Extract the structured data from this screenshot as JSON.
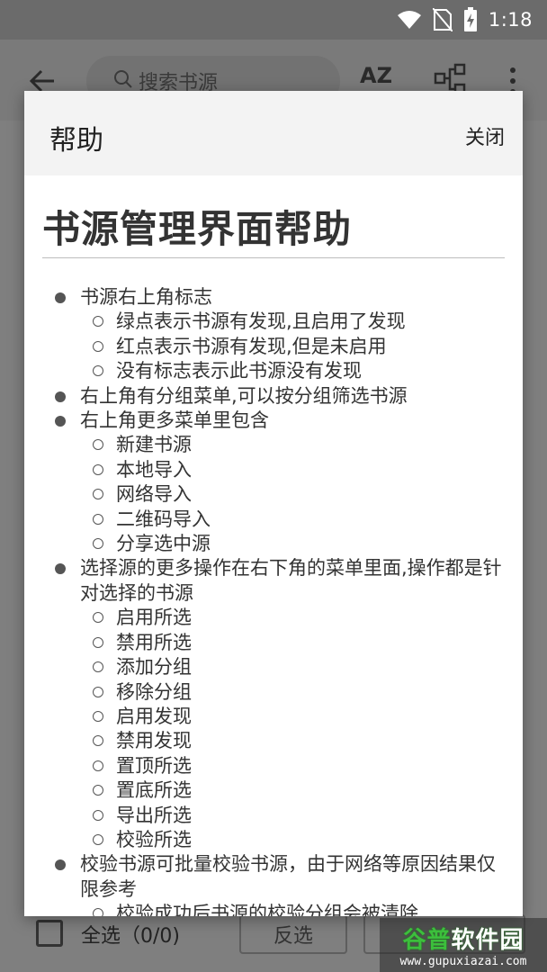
{
  "status_bar": {
    "time": "1:18",
    "icons": [
      "wifi-icon",
      "no-sim-icon",
      "battery-charging-icon"
    ]
  },
  "toolbar": {
    "search_placeholder": "搜索书源",
    "sort_label": "AZ",
    "icons": [
      "back-arrow-icon",
      "search-icon",
      "sort-az-icon",
      "group-icon",
      "more-vert-icon"
    ]
  },
  "bottom_bar": {
    "select_all_label": "全选（0/0)",
    "invert_label": "反选"
  },
  "dialog": {
    "title": "帮助",
    "close_label": "关闭",
    "doc_title": "书源管理界面帮助",
    "items": [
      {
        "text": "书源右上角标志",
        "sub": [
          "绿点表示书源有发现,且启用了发现",
          "红点表示书源有发现,但是未启用",
          "没有标志表示此书源没有发现"
        ]
      },
      {
        "text": "右上角有分组菜单,可以按分组筛选书源",
        "sub": []
      },
      {
        "text": "右上角更多菜单里包含",
        "sub": [
          "新建书源",
          "本地导入",
          "网络导入",
          "二维码导入",
          "分享选中源"
        ]
      },
      {
        "text": "选择源的更多操作在右下角的菜单里面,操作都是针对选择的书源",
        "sub": [
          "启用所选",
          "禁用所选",
          "添加分组",
          "移除分组",
          "启用发现",
          "禁用发现",
          "置顶所选",
          "置底所选",
          "导出所选",
          "校验所选"
        ]
      },
      {
        "text": "校验书源可批量校验书源，由于网络等原因结果仅限参考",
        "sub": [
          "校验成功后书源的校验分组会被清除"
        ]
      }
    ]
  },
  "watermark": {
    "logo_green": "谷普",
    "logo_white": "软件园",
    "url": "www.gupuxiazai.com"
  }
}
